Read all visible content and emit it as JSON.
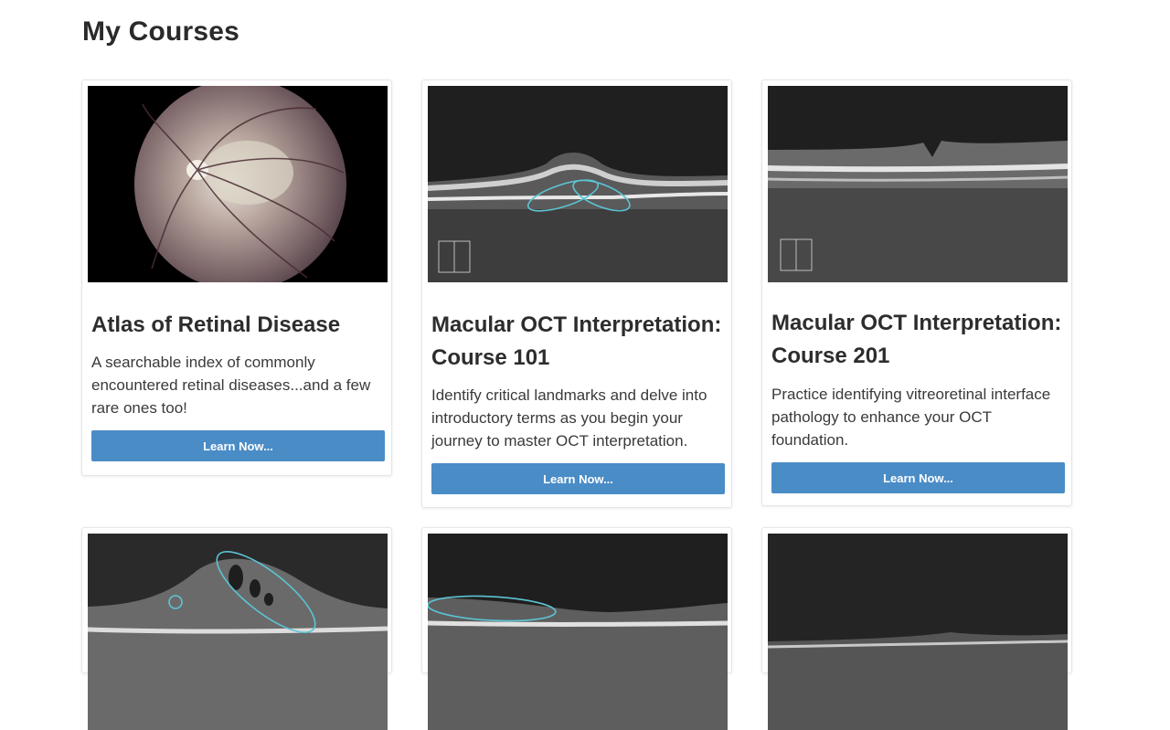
{
  "page": {
    "title": "My Courses"
  },
  "courses": [
    {
      "title": "Atlas of Retinal Disease",
      "description": "A searchable index of commonly encountered retinal diseases...and a few rare ones too!",
      "button_label": "Learn Now...",
      "image": "fundus-photo"
    },
    {
      "title": "Macular OCT Interpretation: Course 101",
      "description": "Identify critical landmarks and delve into introductory terms as you begin your journey to master OCT interpretation.",
      "button_label": "Learn Now...",
      "image": "oct-scan-annotated"
    },
    {
      "title": "Macular OCT Interpretation: Course 201",
      "description": "Practice identifying vitreoretinal interface pathology to enhance your OCT foundation.",
      "button_label": "Learn Now...",
      "image": "oct-scan-macular-hole"
    },
    {
      "image": "oct-scan-cystoid"
    },
    {
      "image": "oct-scan-annotated-2"
    },
    {
      "image": "oct-scan-plain"
    }
  ],
  "colors": {
    "button": "#4a8cc6",
    "annotation": "#5bc4d4"
  }
}
